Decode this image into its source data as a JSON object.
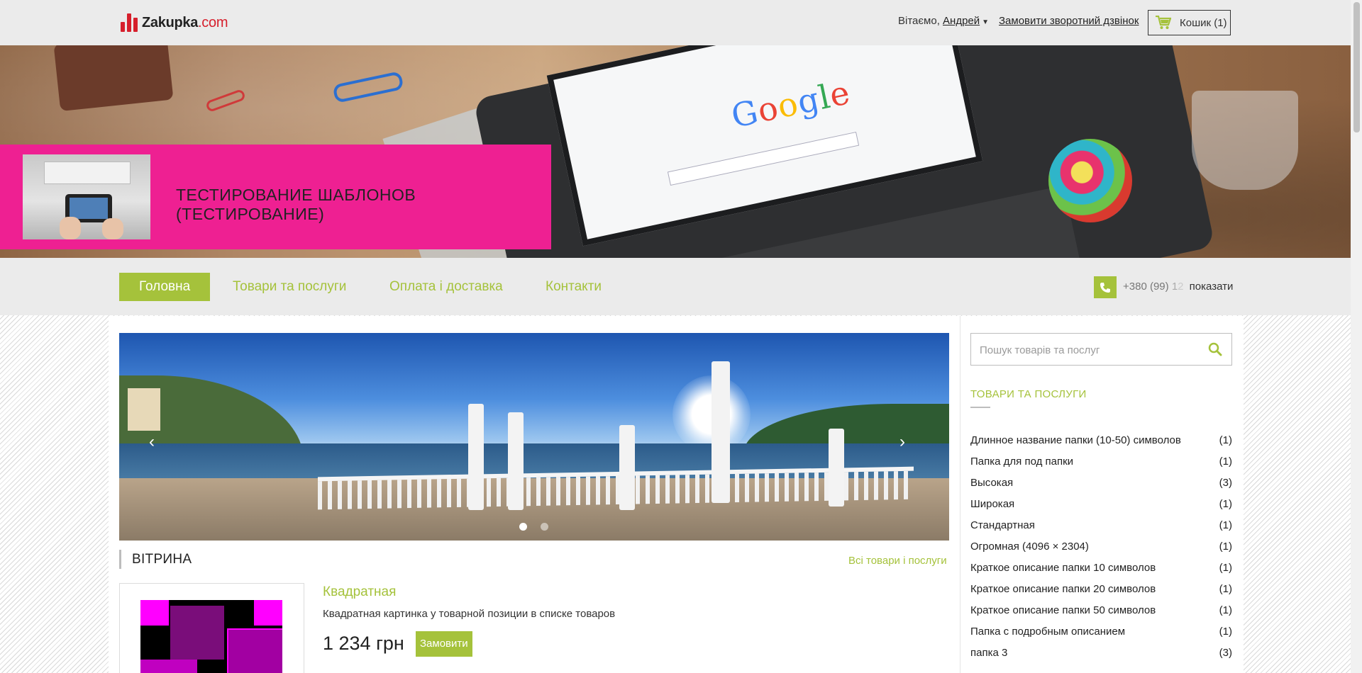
{
  "header": {
    "logo_name": "Zakupka",
    "logo_domain": ".com",
    "greeting": "Вітаємо,",
    "user_name": "Андрей",
    "callback_label": "Замовити зворотний дзвінок",
    "cart_label": "Кошик (1)"
  },
  "banner": {
    "title": "ТЕСТИРОВАНИЕ ШАБЛОНОВ (ТЕСТИРОВАНИЕ)",
    "google_text": "Google",
    "overlay_color": "#ec1c8f"
  },
  "nav": {
    "items": [
      {
        "label": "Головна",
        "active": true
      },
      {
        "label": "Товари та послуги",
        "active": false
      },
      {
        "label": "Оплата і доставка",
        "active": false
      },
      {
        "label": "Контакти",
        "active": false
      }
    ],
    "phone_visible": "+380 (99)",
    "phone_faded": "1",
    "phone_faded2": "2",
    "phone_show": "показати"
  },
  "slider": {
    "slide_count": 2,
    "active_slide": 1
  },
  "showcase": {
    "title": "ВІТРИНА",
    "all_link": "Всі товари і послуги",
    "product": {
      "name": "Квадратная",
      "description": "Квадратная картинка у товарной позиции в списке товаров",
      "price": "1 234 грн",
      "order_label": "Замовити"
    }
  },
  "sidebar": {
    "search_placeholder": "Пошук товарів та послуг",
    "section_title": "ТОВАРИ ТА ПОСЛУГИ",
    "categories": [
      {
        "name": "Длинное название папки (10-50) символов",
        "count": "(1)"
      },
      {
        "name": "Папка для под папки",
        "count": "(1)"
      },
      {
        "name": "Высокая",
        "count": "(3)"
      },
      {
        "name": "Широкая",
        "count": "(1)"
      },
      {
        "name": "Стандартная",
        "count": "(1)"
      },
      {
        "name": "Огромная (4096 × 2304)",
        "count": "(1)"
      },
      {
        "name": "Краткое описание папки 10 символов",
        "count": "(1)"
      },
      {
        "name": "Краткое описание папки 20 символов",
        "count": "(1)"
      },
      {
        "name": "Краткое описание папки 50 символов",
        "count": "(1)"
      },
      {
        "name": "Папка с подробным описанием",
        "count": "(1)"
      },
      {
        "name": "папка 3",
        "count": "(3)"
      }
    ]
  },
  "colors": {
    "accent": "#a5c23b",
    "brand_red": "#d61f2c",
    "banner_pink": "#ec1c8f"
  }
}
